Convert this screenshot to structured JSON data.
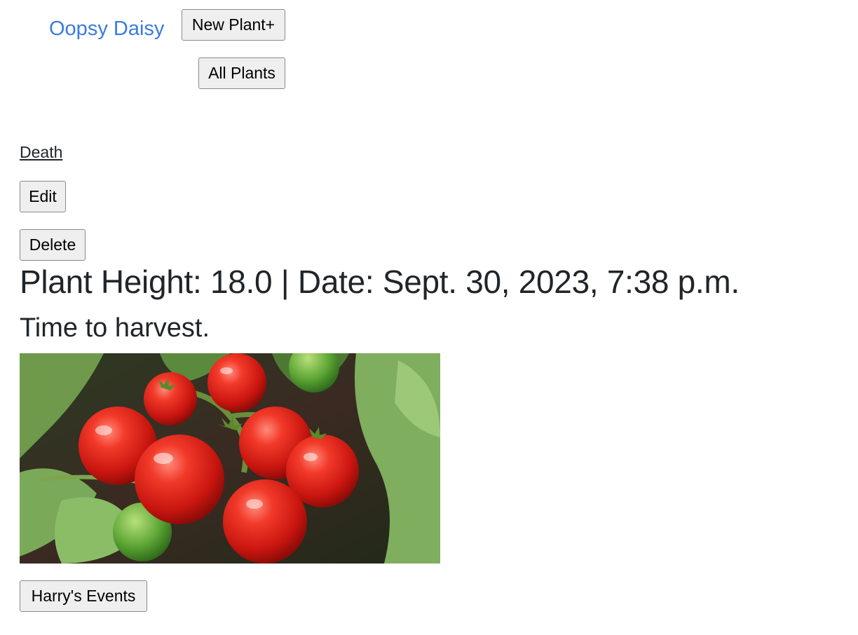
{
  "nav": {
    "brand": "Oopsy Daisy",
    "new_plant_label": "New Plant+",
    "all_plants_label": "All Plants"
  },
  "event": {
    "type_link": "Death",
    "edit_label": "Edit",
    "delete_label": "Delete",
    "heading": "Plant Height: 18.0 | Date: Sept. 30, 2023, 7:38 p.m.",
    "note": "Time to harvest.",
    "image_subject": "tomato-cluster-photo",
    "events_button_label": "Harry's Events"
  },
  "colors": {
    "brand": "#3a7be0",
    "text": "#212529",
    "button_bg": "#efefef"
  }
}
